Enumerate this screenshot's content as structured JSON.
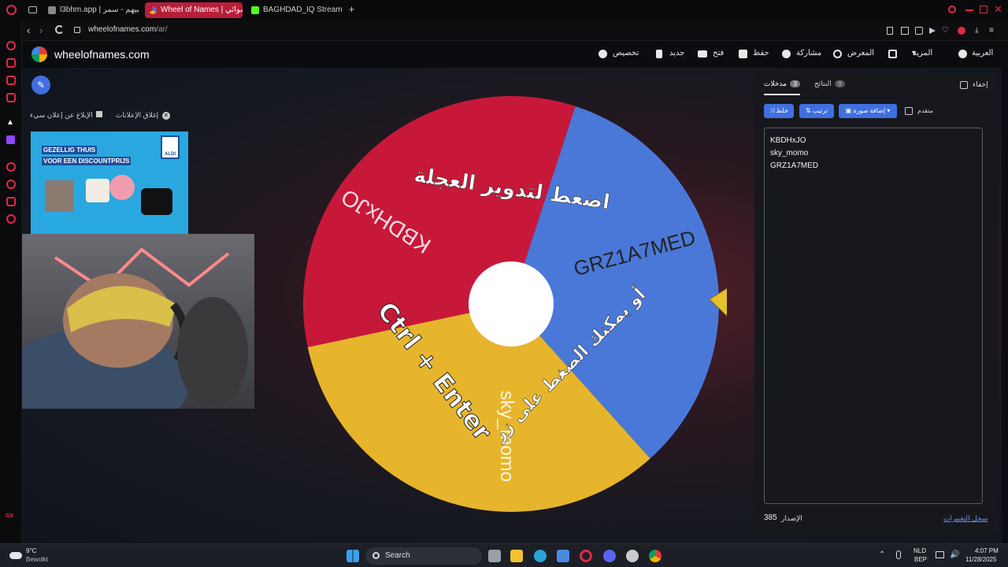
{
  "tabs": [
    {
      "label": "l3bhm.app | لعبيهم - سمر",
      "active": false
    },
    {
      "label": "Wheel of Names | عشوائي",
      "active": true
    },
    {
      "label": "BAGHDAD_IQ Stream - W",
      "active": false
    }
  ],
  "address": {
    "host": "wheelofnames.com",
    "path": "/ar/"
  },
  "site": {
    "logo_text": "wheelofnames.com",
    "nav": {
      "customize": "تخصيص",
      "new": "جديد",
      "open": "فتح",
      "save": "حفظ",
      "share": "مشاركة",
      "gallery": "المعرض",
      "more": "المزيد",
      "language": "العربية"
    },
    "ads": {
      "close_ads": "إغلاق الإعلانات",
      "report_ad": "الإبلاغ عن إعلان سيء",
      "ad_line1": "GEZELLIG THUIS",
      "ad_line2": "VOOR EEN DISCOUNTPRIJS",
      "ad_brand": "ALDI"
    },
    "wheel": {
      "segments": [
        {
          "name": "KBDHxJO",
          "color": "#4a78d8"
        },
        {
          "name": "GRZ1A7MED",
          "color": "#e6b52c"
        },
        {
          "name": "sky_momo",
          "color": "#c8183a"
        }
      ],
      "instruction_1": "اضغط لتدوير العجلة",
      "instruction_2": "أو يمكنك الضغط على زر",
      "shortcut": "Ctrl + Enter"
    },
    "panel": {
      "hide_label": "إخفاء",
      "tab_entries": "مدخلات",
      "tab_entries_count": "3",
      "tab_results": "النتائج",
      "tab_results_count": "0",
      "shuffle": "خلط",
      "sort": "ترتيب",
      "add_image": "إضافة صورة",
      "advanced": "متقدم",
      "entries": [
        "KBDHxJO",
        "sky_momo",
        "GRZ1A7MED"
      ],
      "version_label": "الإصدار",
      "version": "385",
      "changelog": "سجل التغييرات"
    }
  },
  "taskbar": {
    "weather_temp": "9°C",
    "weather_desc": "Bewolkt",
    "search": "Search",
    "lang1": "NLD",
    "lang2": "BEP",
    "time": "4:07 PM",
    "date": "11/28/2025"
  },
  "colors": {
    "accent": "#3f6fe0",
    "opera_red": "#e0284a"
  }
}
